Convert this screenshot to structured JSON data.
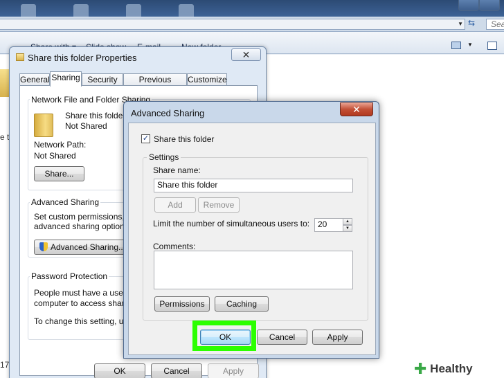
{
  "explorer": {
    "search_placeholder": "Sea",
    "toolbar": {
      "share_with": "Share with ▾",
      "slide_show": "Slide show",
      "email": "E-mail",
      "new_folder": "New folder"
    },
    "left_clip_text": "e t",
    "left_clip_text_bottom": "17"
  },
  "properties": {
    "title": "Share this folder Properties",
    "close_glyph": "✕",
    "tabs": [
      "General",
      "Sharing",
      "Security",
      "Previous Versions",
      "Customize"
    ],
    "active_tab": "Sharing",
    "network_sharing": {
      "label": "Network File and Folder Sharing",
      "folder_name": "Share this folder",
      "folder_status": "Not Shared",
      "network_path_label": "Network Path:",
      "network_path_value": "Not Shared",
      "share_button": "Share..."
    },
    "advanced_sharing": {
      "label": "Advanced Sharing",
      "desc_line1": "Set custom permissions, cre",
      "desc_line2": "advanced sharing options.",
      "button": "Advanced Sharing..."
    },
    "password_protection": {
      "label": "Password Protection",
      "line1": "People must have a user ac",
      "line2": "computer to access shared f",
      "line3": "To change this setting, use t"
    },
    "buttons": {
      "ok": "OK",
      "cancel": "Cancel",
      "apply": "Apply"
    }
  },
  "advanced_dialog": {
    "title": "Advanced Sharing",
    "close_glyph": "✕",
    "share_checkbox": {
      "label": "Share this folder",
      "checked": true,
      "mark": "✓"
    },
    "settings_label": "Settings",
    "share_name_label": "Share name:",
    "share_name_value": "Share this folder",
    "add_button": "Add",
    "remove_button": "Remove",
    "limit_label": "Limit the number of simultaneous users to:",
    "limit_value": "20",
    "spin_up": "▲",
    "spin_down": "▼",
    "comments_label": "Comments:",
    "comments_value": "",
    "permissions_button": "Permissions",
    "caching_button": "Caching",
    "ok_button": "OK",
    "cancel_button": "Cancel",
    "apply_button": "Apply"
  },
  "watermark": {
    "plus": "✚",
    "text": "Healthy Living"
  },
  "colors": {
    "highlight": "#2cff00",
    "close_red": "#c24f35"
  }
}
